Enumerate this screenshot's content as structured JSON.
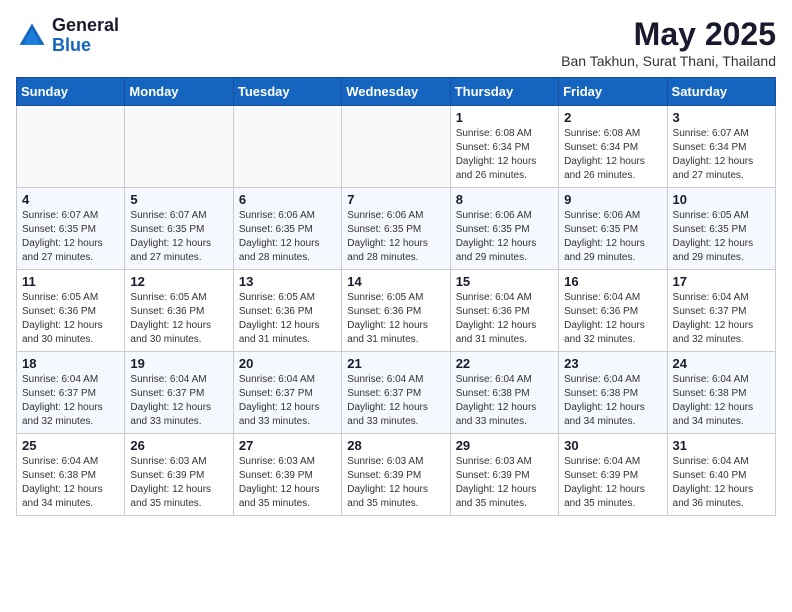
{
  "logo": {
    "general": "General",
    "blue": "Blue"
  },
  "header": {
    "month": "May 2025",
    "location": "Ban Takhun, Surat Thani, Thailand"
  },
  "weekdays": [
    "Sunday",
    "Monday",
    "Tuesday",
    "Wednesday",
    "Thursday",
    "Friday",
    "Saturday"
  ],
  "weeks": [
    [
      {
        "day": "",
        "sunrise": "",
        "sunset": "",
        "daylight": ""
      },
      {
        "day": "",
        "sunrise": "",
        "sunset": "",
        "daylight": ""
      },
      {
        "day": "",
        "sunrise": "",
        "sunset": "",
        "daylight": ""
      },
      {
        "day": "",
        "sunrise": "",
        "sunset": "",
        "daylight": ""
      },
      {
        "day": "1",
        "sunrise": "Sunrise: 6:08 AM",
        "sunset": "Sunset: 6:34 PM",
        "daylight": "Daylight: 12 hours and 26 minutes."
      },
      {
        "day": "2",
        "sunrise": "Sunrise: 6:08 AM",
        "sunset": "Sunset: 6:34 PM",
        "daylight": "Daylight: 12 hours and 26 minutes."
      },
      {
        "day": "3",
        "sunrise": "Sunrise: 6:07 AM",
        "sunset": "Sunset: 6:34 PM",
        "daylight": "Daylight: 12 hours and 27 minutes."
      }
    ],
    [
      {
        "day": "4",
        "sunrise": "Sunrise: 6:07 AM",
        "sunset": "Sunset: 6:35 PM",
        "daylight": "Daylight: 12 hours and 27 minutes."
      },
      {
        "day": "5",
        "sunrise": "Sunrise: 6:07 AM",
        "sunset": "Sunset: 6:35 PM",
        "daylight": "Daylight: 12 hours and 27 minutes."
      },
      {
        "day": "6",
        "sunrise": "Sunrise: 6:06 AM",
        "sunset": "Sunset: 6:35 PM",
        "daylight": "Daylight: 12 hours and 28 minutes."
      },
      {
        "day": "7",
        "sunrise": "Sunrise: 6:06 AM",
        "sunset": "Sunset: 6:35 PM",
        "daylight": "Daylight: 12 hours and 28 minutes."
      },
      {
        "day": "8",
        "sunrise": "Sunrise: 6:06 AM",
        "sunset": "Sunset: 6:35 PM",
        "daylight": "Daylight: 12 hours and 29 minutes."
      },
      {
        "day": "9",
        "sunrise": "Sunrise: 6:06 AM",
        "sunset": "Sunset: 6:35 PM",
        "daylight": "Daylight: 12 hours and 29 minutes."
      },
      {
        "day": "10",
        "sunrise": "Sunrise: 6:05 AM",
        "sunset": "Sunset: 6:35 PM",
        "daylight": "Daylight: 12 hours and 29 minutes."
      }
    ],
    [
      {
        "day": "11",
        "sunrise": "Sunrise: 6:05 AM",
        "sunset": "Sunset: 6:36 PM",
        "daylight": "Daylight: 12 hours and 30 minutes."
      },
      {
        "day": "12",
        "sunrise": "Sunrise: 6:05 AM",
        "sunset": "Sunset: 6:36 PM",
        "daylight": "Daylight: 12 hours and 30 minutes."
      },
      {
        "day": "13",
        "sunrise": "Sunrise: 6:05 AM",
        "sunset": "Sunset: 6:36 PM",
        "daylight": "Daylight: 12 hours and 31 minutes."
      },
      {
        "day": "14",
        "sunrise": "Sunrise: 6:05 AM",
        "sunset": "Sunset: 6:36 PM",
        "daylight": "Daylight: 12 hours and 31 minutes."
      },
      {
        "day": "15",
        "sunrise": "Sunrise: 6:04 AM",
        "sunset": "Sunset: 6:36 PM",
        "daylight": "Daylight: 12 hours and 31 minutes."
      },
      {
        "day": "16",
        "sunrise": "Sunrise: 6:04 AM",
        "sunset": "Sunset: 6:36 PM",
        "daylight": "Daylight: 12 hours and 32 minutes."
      },
      {
        "day": "17",
        "sunrise": "Sunrise: 6:04 AM",
        "sunset": "Sunset: 6:37 PM",
        "daylight": "Daylight: 12 hours and 32 minutes."
      }
    ],
    [
      {
        "day": "18",
        "sunrise": "Sunrise: 6:04 AM",
        "sunset": "Sunset: 6:37 PM",
        "daylight": "Daylight: 12 hours and 32 minutes."
      },
      {
        "day": "19",
        "sunrise": "Sunrise: 6:04 AM",
        "sunset": "Sunset: 6:37 PM",
        "daylight": "Daylight: 12 hours and 33 minutes."
      },
      {
        "day": "20",
        "sunrise": "Sunrise: 6:04 AM",
        "sunset": "Sunset: 6:37 PM",
        "daylight": "Daylight: 12 hours and 33 minutes."
      },
      {
        "day": "21",
        "sunrise": "Sunrise: 6:04 AM",
        "sunset": "Sunset: 6:37 PM",
        "daylight": "Daylight: 12 hours and 33 minutes."
      },
      {
        "day": "22",
        "sunrise": "Sunrise: 6:04 AM",
        "sunset": "Sunset: 6:38 PM",
        "daylight": "Daylight: 12 hours and 33 minutes."
      },
      {
        "day": "23",
        "sunrise": "Sunrise: 6:04 AM",
        "sunset": "Sunset: 6:38 PM",
        "daylight": "Daylight: 12 hours and 34 minutes."
      },
      {
        "day": "24",
        "sunrise": "Sunrise: 6:04 AM",
        "sunset": "Sunset: 6:38 PM",
        "daylight": "Daylight: 12 hours and 34 minutes."
      }
    ],
    [
      {
        "day": "25",
        "sunrise": "Sunrise: 6:04 AM",
        "sunset": "Sunset: 6:38 PM",
        "daylight": "Daylight: 12 hours and 34 minutes."
      },
      {
        "day": "26",
        "sunrise": "Sunrise: 6:03 AM",
        "sunset": "Sunset: 6:39 PM",
        "daylight": "Daylight: 12 hours and 35 minutes."
      },
      {
        "day": "27",
        "sunrise": "Sunrise: 6:03 AM",
        "sunset": "Sunset: 6:39 PM",
        "daylight": "Daylight: 12 hours and 35 minutes."
      },
      {
        "day": "28",
        "sunrise": "Sunrise: 6:03 AM",
        "sunset": "Sunset: 6:39 PM",
        "daylight": "Daylight: 12 hours and 35 minutes."
      },
      {
        "day": "29",
        "sunrise": "Sunrise: 6:03 AM",
        "sunset": "Sunset: 6:39 PM",
        "daylight": "Daylight: 12 hours and 35 minutes."
      },
      {
        "day": "30",
        "sunrise": "Sunrise: 6:04 AM",
        "sunset": "Sunset: 6:39 PM",
        "daylight": "Daylight: 12 hours and 35 minutes."
      },
      {
        "day": "31",
        "sunrise": "Sunrise: 6:04 AM",
        "sunset": "Sunset: 6:40 PM",
        "daylight": "Daylight: 12 hours and 36 minutes."
      }
    ]
  ]
}
